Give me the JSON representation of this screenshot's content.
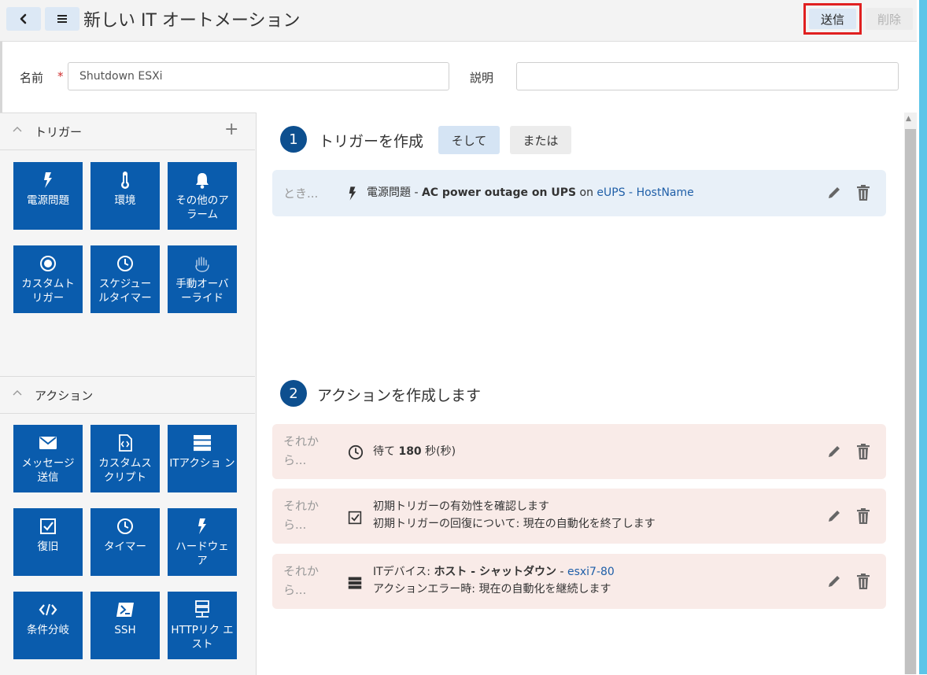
{
  "header": {
    "back_icon": "chevron-left-icon",
    "menu_icon": "hamburger-menu-icon",
    "title": "新しい IT オートメーション",
    "submit_label": "送信",
    "delete_label": "削除"
  },
  "form": {
    "name_label": "名前",
    "required_mark": "*",
    "name_value": "Shutdown ESXi",
    "description_label": "説明",
    "description_value": ""
  },
  "triggers": {
    "section_label": "トリガー",
    "items": [
      {
        "label": "電源問題",
        "icon": "lightning-icon"
      },
      {
        "label": "環境",
        "icon": "thermometer-icon"
      },
      {
        "label": "その他のア ラーム",
        "icon": "bell-icon"
      },
      {
        "label": "カスタムト リガー",
        "icon": "target-icon"
      },
      {
        "label": "スケジュー ルタイマー",
        "icon": "clock-icon"
      },
      {
        "label": "手動オーバ ーライド",
        "icon": "hand-icon"
      }
    ]
  },
  "actions": {
    "section_label": "アクション",
    "items": [
      {
        "label": "メッセージ 送信",
        "icon": "envelope-icon"
      },
      {
        "label": "カスタムス クリプト",
        "icon": "script-file-icon"
      },
      {
        "label": "ITアクショ ン",
        "icon": "server-stack-icon"
      },
      {
        "label": "復旧",
        "icon": "checkbox-icon"
      },
      {
        "label": "タイマー",
        "icon": "clock-icon"
      },
      {
        "label": "ハードウェ ア",
        "icon": "lightning-icon"
      },
      {
        "label": "条件分岐",
        "icon": "code-icon"
      },
      {
        "label": "SSH",
        "icon": "terminal-icon"
      },
      {
        "label": "HTTPリク エスト",
        "icon": "network-icon"
      }
    ]
  },
  "step1": {
    "number": "1",
    "title": "トリガーを作成",
    "and_label": "そして",
    "or_label": "または",
    "trigger_card": {
      "prefix": "とき...",
      "category": "電源問題",
      "separator": " - ",
      "event": "AC power outage on UPS",
      "on_word": " on ",
      "device_link": "eUPS - HostName"
    }
  },
  "step2": {
    "number": "2",
    "title": "アクションを作成します",
    "cards": [
      {
        "prefix_line1": "それか",
        "prefix_line2": "ら...",
        "pre": "待て ",
        "bold": "180",
        "post": " 秒(秒)"
      },
      {
        "prefix_line1": "それか",
        "prefix_line2": "ら...",
        "line1": "初期トリガーの有効性を確認します",
        "line2": "初期トリガーの回復について: 現在の自動化を終了します"
      },
      {
        "prefix_line1": "それか",
        "prefix_line2": "ら...",
        "pre": "ITデバイス: ",
        "bold": "ホスト - シャットダウン",
        "sep": " - ",
        "link": "esxi7-80",
        "line2": "アクションエラー時: 現在の自動化を継続します"
      }
    ]
  },
  "colors": {
    "tile_blue": "#0a5cad",
    "step_circle": "#0d4f8f",
    "link": "#1f5fa8",
    "highlight_border": "#e02020",
    "trigger_card_bg": "#e8f0f8",
    "action_card_bg": "#f9ebe8"
  }
}
